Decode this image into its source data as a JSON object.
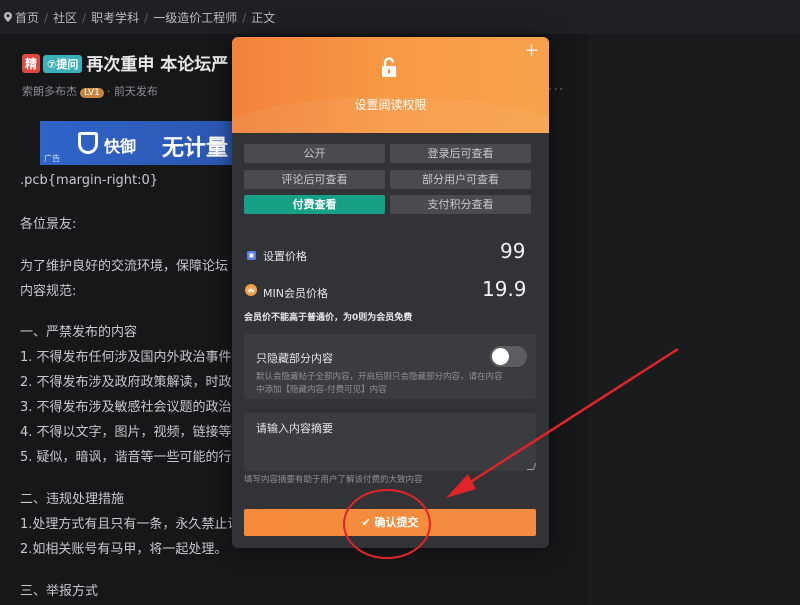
{
  "breadcrumb": [
    "首页",
    "社区",
    "职考学科",
    "一级造价工程师",
    "正文"
  ],
  "article": {
    "badge_jing": "精",
    "badge_ask": "⑦提问",
    "title": "再次重申 本论坛严",
    "author": "索朗多布杰",
    "level": "LV1",
    "time": "· 前天发布",
    "more": "···",
    "banner_brand": "快御",
    "banner_slogan": "无计量",
    "banner_ad": "广告",
    "css_line": ".pcb{margin-right:0}",
    "greeting": "各位景友:",
    "intro_1": "为了维护良好的交流环境，保障论坛",
    "intro_2": "内容规范:",
    "section1": "一、严禁发布的内容",
    "rule1": "1. 不得发布任何涉及国内外政治事件、",
    "rule2": "2. 不得发布涉及政府政策解读，时政",
    "rule3": "3. 不得发布涉及敏感社会议题的政治",
    "rule4": "4. 不得以文字，图片，视频，链接等任",
    "rule5": "5. 疑似，暗讽，谐音等一些可能的行为",
    "section2": "二、违规处理措施",
    "rule6": "1.处理方式有且只有一条，永久禁止访",
    "rule7": "2.如相关账号有马甲，将一起处理。",
    "section3": "三、举报方式"
  },
  "modal": {
    "title": "设置阅读权限",
    "close": "+",
    "tabs": [
      "公开",
      "登录后可查看",
      "评论后可查看",
      "部分用户可查看",
      "付费查看",
      "支付积分查看"
    ],
    "active_tab": "付费查看",
    "price_label": "设置价格",
    "price_value": "99",
    "member_label": "MIN会员价格",
    "member_value": "19.9",
    "member_note": "会员价不能高于普通价，为0则为会员免费",
    "hide_label": "只隐藏部分内容",
    "hide_enabled": false,
    "hide_desc_1": "默认会隐藏帖子全部内容，开启后则只会隐藏部分内容，请在内容",
    "hide_desc_2": "中添加【隐藏内容-付费可见】内容",
    "summary_placeholder": "请输入内容摘要",
    "summary_hint": "填写内容摘要有助于用户了解该付费的大致内容",
    "submit_label": "✔ 确认提交"
  },
  "colors": {
    "accent_orange": "#f48d43",
    "active_tab": "#16a085",
    "annotation_red": "#e0242a"
  }
}
